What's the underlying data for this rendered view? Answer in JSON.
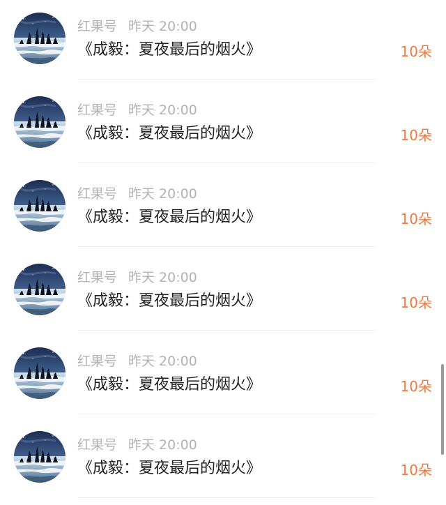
{
  "colors": {
    "accent": "#f07a3a",
    "meta_text": "#b3b3b3",
    "title_text": "#222222"
  },
  "items": [
    {
      "author": "红果号",
      "time": "昨天 20:00",
      "title": "《成毅：夏夜最后的烟火》",
      "count": "10朵"
    },
    {
      "author": "红果号",
      "time": "昨天 20:00",
      "title": "《成毅：夏夜最后的烟火》",
      "count": "10朵"
    },
    {
      "author": "红果号",
      "time": "昨天 20:00",
      "title": "《成毅：夏夜最后的烟火》",
      "count": "10朵"
    },
    {
      "author": "红果号",
      "time": "昨天 20:00",
      "title": "《成毅：夏夜最后的烟火》",
      "count": "10朵"
    },
    {
      "author": "红果号",
      "time": "昨天 20:00",
      "title": "《成毅：夏夜最后的烟火》",
      "count": "10朵"
    },
    {
      "author": "红果号",
      "time": "昨天 20:00",
      "title": "《成毅：夏夜最后的烟火》",
      "count": "10朵"
    }
  ]
}
